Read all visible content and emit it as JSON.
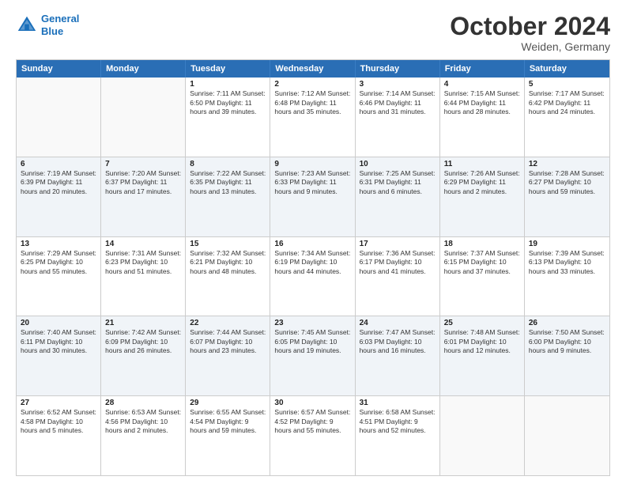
{
  "logo": {
    "line1": "General",
    "line2": "Blue"
  },
  "title": "October 2024",
  "subtitle": "Weiden, Germany",
  "weekdays": [
    "Sunday",
    "Monday",
    "Tuesday",
    "Wednesday",
    "Thursday",
    "Friday",
    "Saturday"
  ],
  "rows": [
    {
      "alt": false,
      "cells": [
        {
          "day": "",
          "info": ""
        },
        {
          "day": "",
          "info": ""
        },
        {
          "day": "1",
          "info": "Sunrise: 7:11 AM\nSunset: 6:50 PM\nDaylight: 11 hours and 39 minutes."
        },
        {
          "day": "2",
          "info": "Sunrise: 7:12 AM\nSunset: 6:48 PM\nDaylight: 11 hours and 35 minutes."
        },
        {
          "day": "3",
          "info": "Sunrise: 7:14 AM\nSunset: 6:46 PM\nDaylight: 11 hours and 31 minutes."
        },
        {
          "day": "4",
          "info": "Sunrise: 7:15 AM\nSunset: 6:44 PM\nDaylight: 11 hours and 28 minutes."
        },
        {
          "day": "5",
          "info": "Sunrise: 7:17 AM\nSunset: 6:42 PM\nDaylight: 11 hours and 24 minutes."
        }
      ]
    },
    {
      "alt": true,
      "cells": [
        {
          "day": "6",
          "info": "Sunrise: 7:19 AM\nSunset: 6:39 PM\nDaylight: 11 hours and 20 minutes."
        },
        {
          "day": "7",
          "info": "Sunrise: 7:20 AM\nSunset: 6:37 PM\nDaylight: 11 hours and 17 minutes."
        },
        {
          "day": "8",
          "info": "Sunrise: 7:22 AM\nSunset: 6:35 PM\nDaylight: 11 hours and 13 minutes."
        },
        {
          "day": "9",
          "info": "Sunrise: 7:23 AM\nSunset: 6:33 PM\nDaylight: 11 hours and 9 minutes."
        },
        {
          "day": "10",
          "info": "Sunrise: 7:25 AM\nSunset: 6:31 PM\nDaylight: 11 hours and 6 minutes."
        },
        {
          "day": "11",
          "info": "Sunrise: 7:26 AM\nSunset: 6:29 PM\nDaylight: 11 hours and 2 minutes."
        },
        {
          "day": "12",
          "info": "Sunrise: 7:28 AM\nSunset: 6:27 PM\nDaylight: 10 hours and 59 minutes."
        }
      ]
    },
    {
      "alt": false,
      "cells": [
        {
          "day": "13",
          "info": "Sunrise: 7:29 AM\nSunset: 6:25 PM\nDaylight: 10 hours and 55 minutes."
        },
        {
          "day": "14",
          "info": "Sunrise: 7:31 AM\nSunset: 6:23 PM\nDaylight: 10 hours and 51 minutes."
        },
        {
          "day": "15",
          "info": "Sunrise: 7:32 AM\nSunset: 6:21 PM\nDaylight: 10 hours and 48 minutes."
        },
        {
          "day": "16",
          "info": "Sunrise: 7:34 AM\nSunset: 6:19 PM\nDaylight: 10 hours and 44 minutes."
        },
        {
          "day": "17",
          "info": "Sunrise: 7:36 AM\nSunset: 6:17 PM\nDaylight: 10 hours and 41 minutes."
        },
        {
          "day": "18",
          "info": "Sunrise: 7:37 AM\nSunset: 6:15 PM\nDaylight: 10 hours and 37 minutes."
        },
        {
          "day": "19",
          "info": "Sunrise: 7:39 AM\nSunset: 6:13 PM\nDaylight: 10 hours and 33 minutes."
        }
      ]
    },
    {
      "alt": true,
      "cells": [
        {
          "day": "20",
          "info": "Sunrise: 7:40 AM\nSunset: 6:11 PM\nDaylight: 10 hours and 30 minutes."
        },
        {
          "day": "21",
          "info": "Sunrise: 7:42 AM\nSunset: 6:09 PM\nDaylight: 10 hours and 26 minutes."
        },
        {
          "day": "22",
          "info": "Sunrise: 7:44 AM\nSunset: 6:07 PM\nDaylight: 10 hours and 23 minutes."
        },
        {
          "day": "23",
          "info": "Sunrise: 7:45 AM\nSunset: 6:05 PM\nDaylight: 10 hours and 19 minutes."
        },
        {
          "day": "24",
          "info": "Sunrise: 7:47 AM\nSunset: 6:03 PM\nDaylight: 10 hours and 16 minutes."
        },
        {
          "day": "25",
          "info": "Sunrise: 7:48 AM\nSunset: 6:01 PM\nDaylight: 10 hours and 12 minutes."
        },
        {
          "day": "26",
          "info": "Sunrise: 7:50 AM\nSunset: 6:00 PM\nDaylight: 10 hours and 9 minutes."
        }
      ]
    },
    {
      "alt": false,
      "cells": [
        {
          "day": "27",
          "info": "Sunrise: 6:52 AM\nSunset: 4:58 PM\nDaylight: 10 hours and 5 minutes."
        },
        {
          "day": "28",
          "info": "Sunrise: 6:53 AM\nSunset: 4:56 PM\nDaylight: 10 hours and 2 minutes."
        },
        {
          "day": "29",
          "info": "Sunrise: 6:55 AM\nSunset: 4:54 PM\nDaylight: 9 hours and 59 minutes."
        },
        {
          "day": "30",
          "info": "Sunrise: 6:57 AM\nSunset: 4:52 PM\nDaylight: 9 hours and 55 minutes."
        },
        {
          "day": "31",
          "info": "Sunrise: 6:58 AM\nSunset: 4:51 PM\nDaylight: 9 hours and 52 minutes."
        },
        {
          "day": "",
          "info": ""
        },
        {
          "day": "",
          "info": ""
        }
      ]
    }
  ]
}
